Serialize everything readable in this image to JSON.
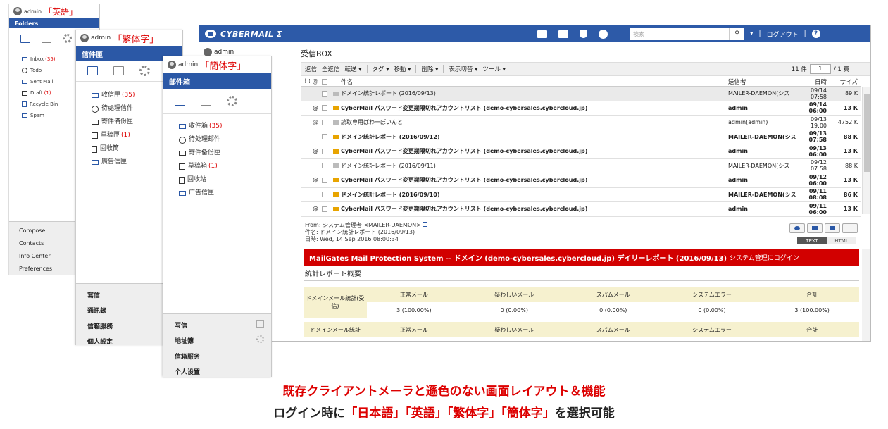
{
  "panel_en": {
    "user": "admin",
    "lang": "「英語」",
    "header": "Folders",
    "folders": [
      {
        "label": "Inbox",
        "count": "(35)"
      },
      {
        "label": "Todo",
        "count": ""
      },
      {
        "label": "Sent Mail",
        "count": ""
      },
      {
        "label": "Draft",
        "count": "(1)"
      },
      {
        "label": "Recycle Bin",
        "count": ""
      },
      {
        "label": "Spam",
        "count": ""
      }
    ],
    "nav": [
      "Compose",
      "Contacts",
      "Info Center",
      "Preferences"
    ]
  },
  "panel_tw": {
    "user": "admin",
    "lang": "「繁体字」",
    "header": "信件匣",
    "folders": [
      {
        "label": "收信匣",
        "count": "(35)"
      },
      {
        "label": "待處理信件",
        "count": ""
      },
      {
        "label": "寄件備份匣",
        "count": ""
      },
      {
        "label": "草稿匣",
        "count": "(1)"
      },
      {
        "label": "回收筒",
        "count": ""
      },
      {
        "label": "廣告信匣",
        "count": ""
      }
    ],
    "nav": [
      "寫信",
      "通訊錄",
      "信箱服務",
      "個人設定"
    ]
  },
  "panel_cn": {
    "user": "admin",
    "lang": "「簡体字」",
    "header": "邮件箱",
    "folders": [
      {
        "label": "收件箱",
        "count": "(35)"
      },
      {
        "label": "待处理邮件",
        "count": ""
      },
      {
        "label": "寄件备份匣",
        "count": ""
      },
      {
        "label": "草稿箱",
        "count": "(1)"
      },
      {
        "label": "回收站",
        "count": ""
      },
      {
        "label": "广告信匣",
        "count": ""
      }
    ],
    "nav": [
      "写信",
      "地址簿",
      "信箱服务",
      "个人设置"
    ]
  },
  "main": {
    "logo": "CYBERMAIL Σ",
    "search_placeholder": "検索",
    "logout": "ログアウト",
    "help": "?",
    "user": "admin",
    "title": "受信BOX",
    "toolbar": [
      "返信",
      "全返信",
      "転送 ▾",
      "タグ ▾",
      "移動 ▾",
      "削除 ▾",
      "表示切替 ▾",
      "ツール ▾"
    ],
    "pager": {
      "count": "11 件",
      "page": "1",
      "total": "/ 1 頁"
    },
    "columns": {
      "subject": "件名",
      "from": "送信者",
      "date": "日時",
      "size": "サイズ"
    },
    "rows": [
      {
        "att": "",
        "subject": "ドメイン統計レポート (2016/09/13)",
        "from": "MAILER-DAEMON(シス",
        "date": "09/14 07:58",
        "size": "89 K",
        "style": "grey",
        "env": "open"
      },
      {
        "att": "@",
        "subject": "CyberMail パスワード変更期限切れアカウントリスト (demo-cybersales.cybercloud.jp)",
        "from": "admin",
        "date": "09/14 06:00",
        "size": "13 K",
        "style": "bold",
        "env": "new"
      },
      {
        "att": "@",
        "subject": "読取専用ぱわーぽいんと",
        "from": "admin(admin)",
        "date": "09/13 19:00",
        "size": "4752 K",
        "style": "",
        "env": "open"
      },
      {
        "att": "",
        "subject": "ドメイン統計レポート (2016/09/12)",
        "from": "MAILER-DAEMON(シス",
        "date": "09/13 07:58",
        "size": "88 K",
        "style": "bold",
        "env": "new"
      },
      {
        "att": "@",
        "subject": "CyberMail パスワード変更期限切れアカウントリスト (demo-cybersales.cybercloud.jp)",
        "from": "admin",
        "date": "09/13 06:00",
        "size": "13 K",
        "style": "bold",
        "env": "new"
      },
      {
        "att": "",
        "subject": "ドメイン統計レポート (2016/09/11)",
        "from": "MAILER-DAEMON(シス",
        "date": "09/12 07:58",
        "size": "88 K",
        "style": "",
        "env": "open"
      },
      {
        "att": "@",
        "subject": "CyberMail パスワード変更期限切れアカウントリスト (demo-cybersales.cybercloud.jp)",
        "from": "admin",
        "date": "09/12 06:00",
        "size": "13 K",
        "style": "bold",
        "env": "new"
      },
      {
        "att": "",
        "subject": "ドメイン統計レポート (2016/09/10)",
        "from": "MAILER-DAEMON(シス",
        "date": "09/11 08:08",
        "size": "86 K",
        "style": "bold",
        "env": "new"
      },
      {
        "att": "@",
        "subject": "CyberMail パスワード変更期限切れアカウントリスト (demo-cybersales.cybercloud.jp)",
        "from": "admin",
        "date": "09/11 06:00",
        "size": "13 K",
        "style": "bold",
        "env": "new"
      }
    ],
    "preview": {
      "from_label": "From:",
      "from": "システム管理者 <MAILER-DAEMON>",
      "subject_label": "件名:",
      "subject": "ドメイン統計レポート (2016/09/13)",
      "date_label": "日時:",
      "date": "Wed, 14 Sep 2016 08:00:34",
      "tab_text": "TEXT",
      "tab_html": "HTML",
      "banner": "MailGates Mail Protection System -- ドメイン (demo-cybersales.cybercloud.jp) デイリーレポート (2016/09/13)",
      "banner_link": "システム管理にログイン",
      "section": "統計レポート概要",
      "table_headers": [
        "正常メール",
        "疑わしいメール",
        "スパムメール",
        "システムエラー",
        "合計"
      ],
      "row1_label": "ドメインメール統計(受信)",
      "row1_values": [
        "3 (100.00%)",
        "0 (0.00%)",
        "0 (0.00%)",
        "0 (0.00%)",
        "3 (100.00%)"
      ],
      "row2_label": "ドメインメール統計"
    }
  },
  "footer": {
    "line1": "既存クライアントメーラと遜色のない画面レイアウト＆機能",
    "line2_a": "ログイン時に",
    "line2_b": "「日本語」「英語」「繁体字」「簡体字」",
    "line2_c": "を選択可能"
  }
}
